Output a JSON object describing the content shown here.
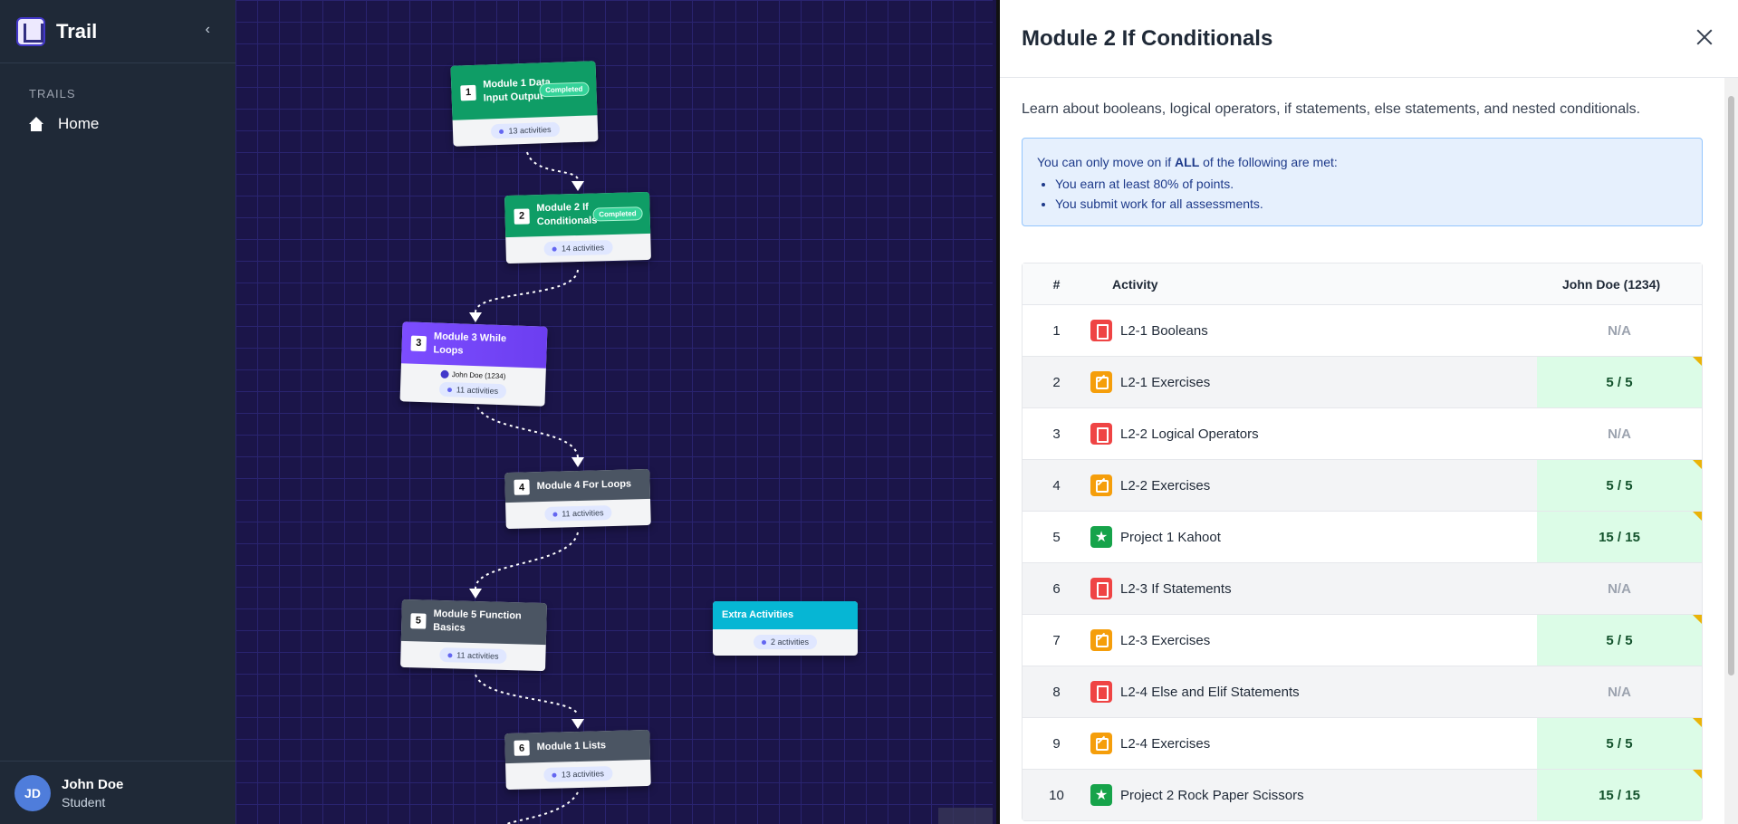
{
  "app": {
    "name": "Trail"
  },
  "sidebar": {
    "section_label": "TRAILS",
    "items": [
      {
        "label": "Home",
        "icon": "home-icon"
      }
    ],
    "user": {
      "initials": "JD",
      "name": "John Doe",
      "role": "Student"
    }
  },
  "canvas": {
    "nodes": [
      {
        "num": "1",
        "title": "Module 1 Data Input Output",
        "badge": "Completed",
        "activities": "13 activities",
        "status": "completed"
      },
      {
        "num": "2",
        "title": "Module 2 If Conditionals",
        "badge": "Completed",
        "activities": "14 activities",
        "status": "completed"
      },
      {
        "num": "3",
        "title": "Module 3 While Loops",
        "user": "John Doe (1234)",
        "activities": "11 activities",
        "status": "current"
      },
      {
        "num": "4",
        "title": "Module 4 For Loops",
        "activities": "11 activities",
        "status": "locked"
      },
      {
        "num": "5",
        "title": "Module 5 Function Basics",
        "activities": "11 activities",
        "status": "locked"
      },
      {
        "num": "6",
        "title": "Module 1 Lists",
        "activities": "13 activities",
        "status": "locked"
      },
      {
        "title": "Extra Activities",
        "activities": "2 activities",
        "status": "extra"
      }
    ]
  },
  "panel": {
    "title": "Module 2 If Conditionals",
    "description": "Learn about booleans, logical operators, if statements, else statements, and nested conditionals.",
    "notice": {
      "prefix": "You can only move on if ",
      "emphasis": "ALL",
      "suffix": " of the following are met:",
      "rules": [
        "You earn at least 80% of points.",
        "You submit work for all assessments."
      ]
    },
    "table": {
      "headers": {
        "num": "#",
        "activity": "Activity",
        "student": "John Doe (1234)"
      },
      "rows": [
        {
          "num": "1",
          "name": "L2-1 Booleans",
          "type": "book",
          "score": "N/A"
        },
        {
          "num": "2",
          "name": "L2-1 Exercises",
          "type": "pencil",
          "score": "5 / 5"
        },
        {
          "num": "3",
          "name": "L2-2 Logical Operators",
          "type": "book",
          "score": "N/A"
        },
        {
          "num": "4",
          "name": "L2-2 Exercises",
          "type": "pencil",
          "score": "5 / 5"
        },
        {
          "num": "5",
          "name": "Project 1 Kahoot",
          "type": "star",
          "score": "15 / 15"
        },
        {
          "num": "6",
          "name": "L2-3 If Statements",
          "type": "book",
          "score": "N/A"
        },
        {
          "num": "7",
          "name": "L2-3 Exercises",
          "type": "pencil",
          "score": "5 / 5"
        },
        {
          "num": "8",
          "name": "L2-4 Else and Elif Statements",
          "type": "book",
          "score": "N/A"
        },
        {
          "num": "9",
          "name": "L2-4 Exercises",
          "type": "pencil",
          "score": "5 / 5"
        },
        {
          "num": "10",
          "name": "Project 2 Rock Paper Scissors",
          "type": "star",
          "score": "15 / 15"
        }
      ]
    }
  }
}
